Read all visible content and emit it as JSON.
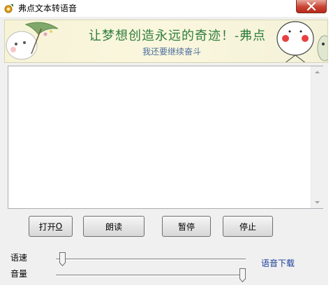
{
  "window": {
    "title": "弗点文本转语音"
  },
  "banner": {
    "slogan_main": "让梦想创造永远的奇迹！-弗点",
    "slogan_sub": "我还要继续奋斗"
  },
  "editor": {
    "value": "",
    "placeholder": ""
  },
  "buttons": {
    "open_label": "打开 ",
    "open_hotkey": "O",
    "read_label": "朗读",
    "pause_label": "暂停",
    "stop_label": "停止"
  },
  "controls": {
    "speed_label": "语速",
    "volume_label": "音量",
    "speed_value": 0.02,
    "volume_value": 1.0,
    "download_link": "语音下载"
  },
  "colors": {
    "slogan_main": "#2f7d3c",
    "slogan_sub": "#4c6e9c",
    "link": "#1a3d9a",
    "close_button": "#c94333"
  }
}
